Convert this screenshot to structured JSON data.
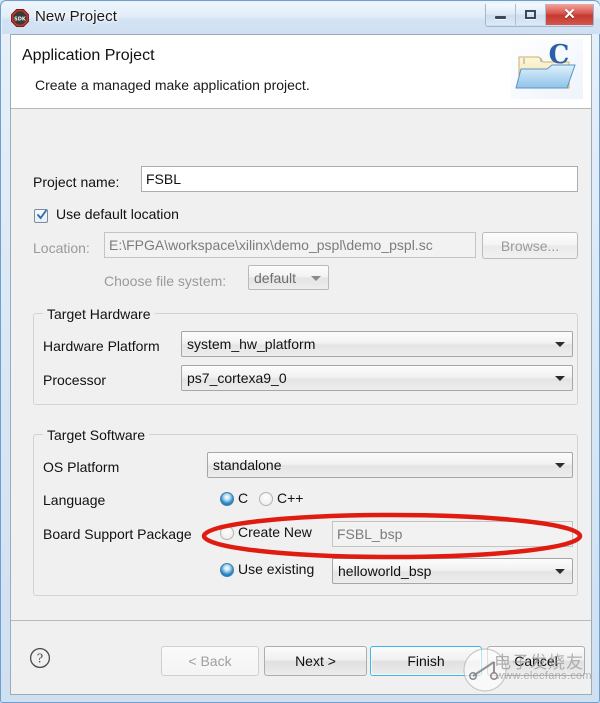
{
  "window": {
    "title": "New Project",
    "icon": "sdk-octagon-icon",
    "controls": {
      "minimize": "minimize-icon",
      "maximize": "maximize-icon",
      "close": "close-icon"
    }
  },
  "banner": {
    "title": "Application Project",
    "subtitle": "Create a managed make application project.",
    "icon": "c-project-folder-icon"
  },
  "form": {
    "project_name_label": "Project name:",
    "project_name_value": "FSBL",
    "use_default_location_label": "Use default location",
    "use_default_location_checked": true,
    "location_label": "Location:",
    "location_value": "E:\\FPGA\\workspace\\xilinx\\demo_pspl\\demo_pspl.sc",
    "browse_label": "Browse...",
    "choose_file_system_label": "Choose file system:",
    "choose_file_system_value": "default"
  },
  "target_hardware": {
    "group_title": "Target Hardware",
    "hardware_platform_label": "Hardware Platform",
    "hardware_platform_value": "system_hw_platform",
    "processor_label": "Processor",
    "processor_value": "ps7_cortexa9_0"
  },
  "target_software": {
    "group_title": "Target Software",
    "os_platform_label": "OS Platform",
    "os_platform_value": "standalone",
    "language_label": "Language",
    "language_c_label": "C",
    "language_cpp_label": "C++",
    "language_selected": "C",
    "bsp_label": "Board Support Package",
    "bsp_create_new_label": "Create New",
    "bsp_create_new_value": "FSBL_bsp",
    "bsp_use_existing_label": "Use existing",
    "bsp_use_existing_value": "helloworld_bsp",
    "bsp_selected": "Use existing"
  },
  "footer": {
    "help_icon": "help-question-icon",
    "back_label": "< Back",
    "next_label": "Next >",
    "finish_label": "Finish",
    "cancel_label": "Cancel"
  },
  "watermark": {
    "text": "电子发烧友",
    "url": "www.elecfans.com"
  },
  "colors": {
    "annotation": "#e01b10",
    "focus": "#3ab7e8",
    "accent": "#2b8ccc",
    "close_button": "#c33a30"
  }
}
